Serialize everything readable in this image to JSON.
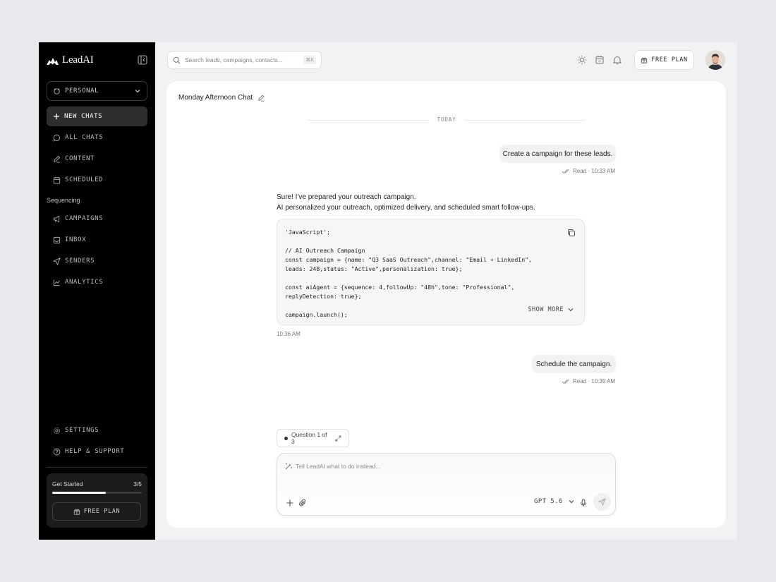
{
  "brand": {
    "name": "LeadAI"
  },
  "sidebar": {
    "workspace": "PERSONAL",
    "new_chat": "NEW CHATS",
    "items": [
      {
        "label": "ALL CHATS",
        "icon": "chat-bubble-icon"
      },
      {
        "label": "CONTENT",
        "icon": "pencil-icon"
      },
      {
        "label": "SCHEDULED",
        "icon": "calendar-icon"
      }
    ],
    "section_title": "Sequencing",
    "sequencing_items": [
      {
        "label": "CAMPAIGNS",
        "icon": "megaphone-icon"
      },
      {
        "label": "INBOX",
        "icon": "inbox-icon"
      },
      {
        "label": "SENDERS",
        "icon": "send-icon"
      },
      {
        "label": "ANALYTICS",
        "icon": "chart-icon"
      }
    ],
    "bottom_items": [
      {
        "label": "SETTINGS",
        "icon": "gear-icon"
      },
      {
        "label": "HELP & SUPPORT",
        "icon": "help-icon"
      }
    ],
    "get_started": {
      "title": "Get Started",
      "count": "3/5",
      "progress": 0.6,
      "button": "FREE PLAN"
    }
  },
  "topbar": {
    "search_placeholder": "Search leads, campaigns, contacts...",
    "shortcut": "⌘K",
    "plan_button": "FREE PLAN"
  },
  "chat": {
    "title": "Monday Afternoon Chat",
    "divider": "TODAY",
    "user_msg_1": {
      "text": "Create a campaign for these leads.",
      "status": "Read · 10:33 AM"
    },
    "ai_msg": {
      "line1": "Sure! I've prepared your outreach campaign.",
      "line2": "AI personalized your outreach, optimized delivery, and scheduled smart follow-ups.",
      "code": "'JavaScript';\n\n// AI Outreach Campaign\nconst campaign = {name: \"Q3 SaaS Outreach\",channel: \"Email + LinkedIn\",\nleads: 248,status: \"Active\",personalization: true};\n\nconst aiAgent = {sequence: 4,followUp: \"48h\",tone: \"Professional\",\nreplyDetection: true};\n\ncampaign.launch();",
      "show_more": "SHOW MORE",
      "time": "10:36 AM"
    },
    "user_msg_2": {
      "text": "Schedule the campaign.",
      "status": "Read · 10:39 AM"
    }
  },
  "composer": {
    "question": "Question 1 of 3",
    "placeholder": "Tell LeadAI what to do instead...",
    "model": "GPT 5.6"
  }
}
